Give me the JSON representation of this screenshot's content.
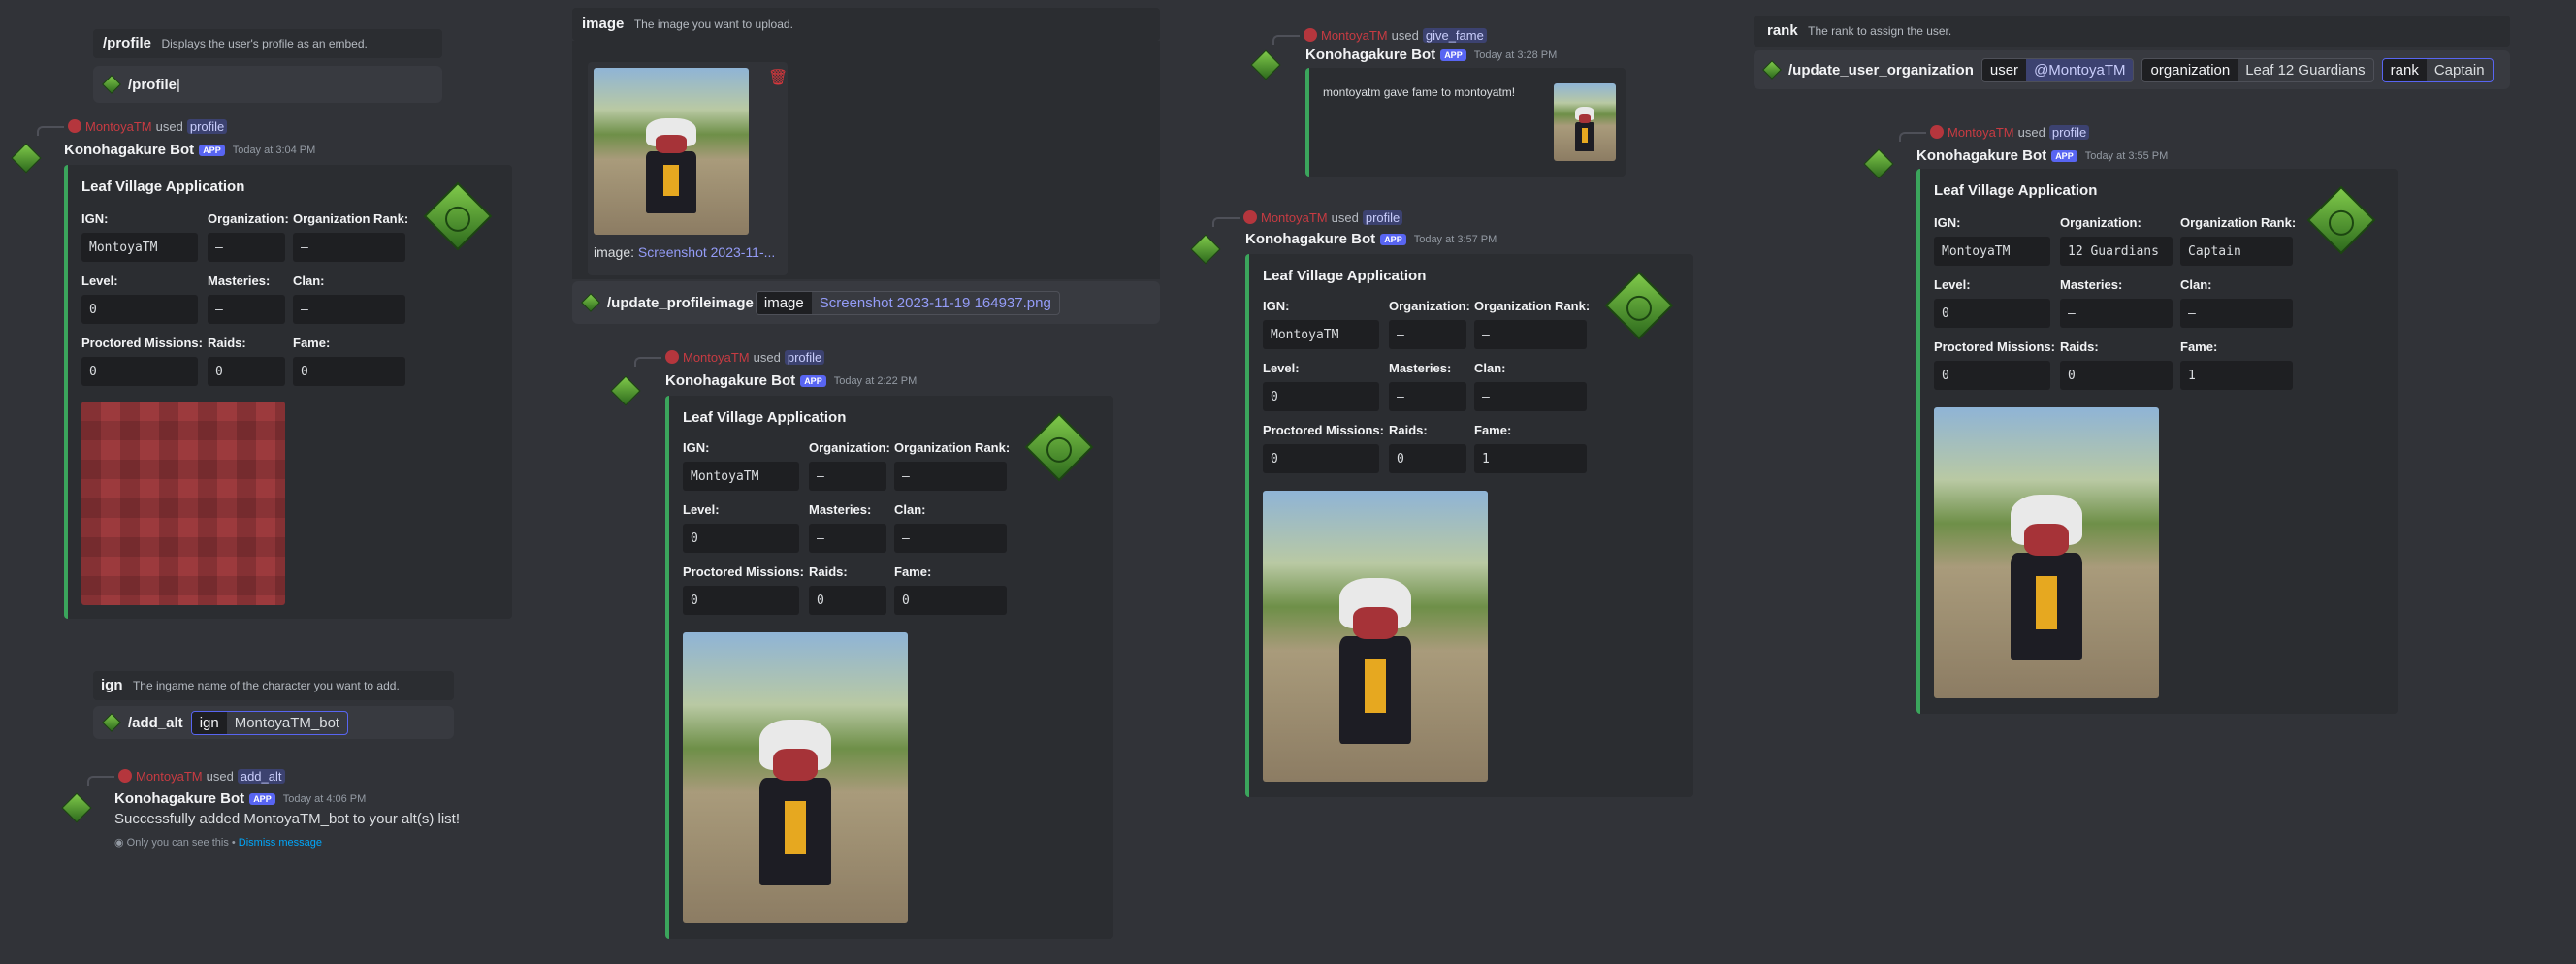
{
  "colors": {
    "accent": "#5865f2",
    "embed_bar": "#3ba55c",
    "mention_bg": "#3c4270",
    "bg": "#313338"
  },
  "hint_profile": {
    "name": "/profile",
    "desc": "Displays the user's profile as an embed."
  },
  "bar_profile": {
    "cmd": "/profile"
  },
  "hint_image": {
    "name": "image",
    "desc": "The image you want to upload."
  },
  "upload": {
    "caption_label": "image:",
    "caption_file": "Screenshot 2023-11-..."
  },
  "bar_profileimage": {
    "cmd": "/update_profileimage",
    "opt_key": "image",
    "opt_val": "Screenshot 2023-11-19 164937.png"
  },
  "hint_ign": {
    "name": "ign",
    "desc": "The ingame name of the character you want to add."
  },
  "bar_add_alt": {
    "cmd": "/add_alt",
    "opt_key": "ign",
    "opt_val": "MontoyaTM_bot"
  },
  "hint_rank": {
    "name": "rank",
    "desc": "The rank to assign the user."
  },
  "bar_org": {
    "cmd": "/update_user_organization",
    "opts": [
      {
        "k": "user",
        "v": "@MontoyaTM"
      },
      {
        "k": "organization",
        "v": "Leaf 12 Guardians"
      },
      {
        "k": "rank",
        "v": "Captain"
      }
    ]
  },
  "common": {
    "username": "MontoyaTM",
    "used": "used",
    "bot": "Konohagakure Bot",
    "app": "APP",
    "embed_title": "Leaf Village Application",
    "labels": {
      "ign": "IGN:",
      "org": "Organization:",
      "rank": "Organization Rank:",
      "level": "Level:",
      "masteries": "Masteries:",
      "clan": "Clan:",
      "missions": "Proctored Missions:",
      "raids": "Raids:",
      "fame": "Fame:"
    }
  },
  "msg1": {
    "cmd": "profile",
    "time": "Today at 3:04 PM",
    "ign": "MontoyaTM",
    "org": "—",
    "rank": "—",
    "level": "0",
    "masteries": "—",
    "clan": "—",
    "missions": "0",
    "raids": "0",
    "fame": "0"
  },
  "msg2": {
    "cmd": "profile",
    "time": "Today at 2:22 PM",
    "ign": "MontoyaTM",
    "org": "—",
    "rank": "—",
    "level": "0",
    "masteries": "—",
    "clan": "—",
    "missions": "0",
    "raids": "0",
    "fame": "0"
  },
  "msg3": {
    "cmd": "give_fame",
    "time": "Today at 3:28 PM",
    "text": "montoyatm gave fame to montoyatm!"
  },
  "msg4": {
    "cmd": "profile",
    "time": "Today at 3:57 PM",
    "ign": "MontoyaTM",
    "org": "—",
    "rank": "—",
    "level": "0",
    "masteries": "—",
    "clan": "—",
    "missions": "0",
    "raids": "0",
    "fame": "1"
  },
  "msg5": {
    "cmd": "profile",
    "time": "Today at 3:55 PM",
    "ign": "MontoyaTM",
    "org": "12 Guardians",
    "rank": "Captain",
    "level": "0",
    "masteries": "—",
    "clan": "—",
    "missions": "0",
    "raids": "0",
    "fame": "1"
  },
  "msg6": {
    "cmd": "add_alt",
    "time": "Today at 4:06 PM",
    "text": "Successfully added MontoyaTM_bot to your alt(s) list!",
    "note": "Only you can see this •",
    "dismiss": "Dismiss message"
  }
}
